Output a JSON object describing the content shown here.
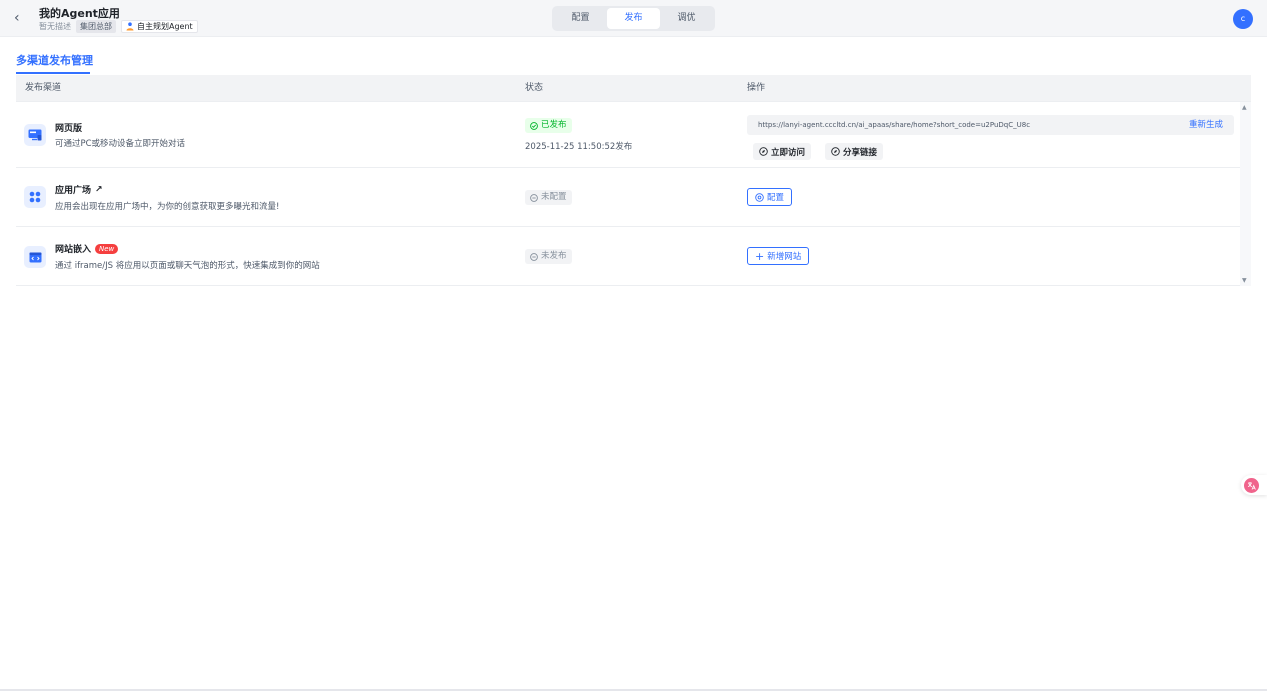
{
  "header": {
    "title": "我的Agent应用",
    "description": "暂无描述",
    "org_tag": "集团总部",
    "agent_tag": "自主规划Agent",
    "tabs": [
      "配置",
      "发布",
      "调优"
    ],
    "active_tab": "发布",
    "avatar": "c"
  },
  "section_tab": "多渠道发布管理",
  "table": {
    "columns": [
      "发布渠道",
      "状态",
      "操作"
    ],
    "rows": [
      {
        "name": "网页版",
        "description": "可通过PC或移动设备立即开始对话",
        "status": "已发布",
        "published_time": "2025-11-25 11:50:52发布",
        "url": "https://lanyi-agent.cccltd.cn/ai_apaas/share/home?short_code=u2PuDqC_U8c",
        "regen_label": "重新生成",
        "visit_label": "立即访问",
        "share_label": "分享链接"
      },
      {
        "name": "应用广场",
        "description": "应用会出现在应用广场中，为你的创意获取更多曝光和流量!",
        "status": "未配置",
        "action_label": "配置"
      },
      {
        "name": "网站嵌入",
        "badge": "New",
        "description": "通过 iframe/JS 将应用以页面或聊天气泡的形式，快速集成到你的网站",
        "status": "未发布",
        "action_label": "新增网站"
      }
    ]
  },
  "colors": {
    "primary": "#3370ff",
    "success": "#00b42a",
    "danger": "#f53f3f"
  }
}
